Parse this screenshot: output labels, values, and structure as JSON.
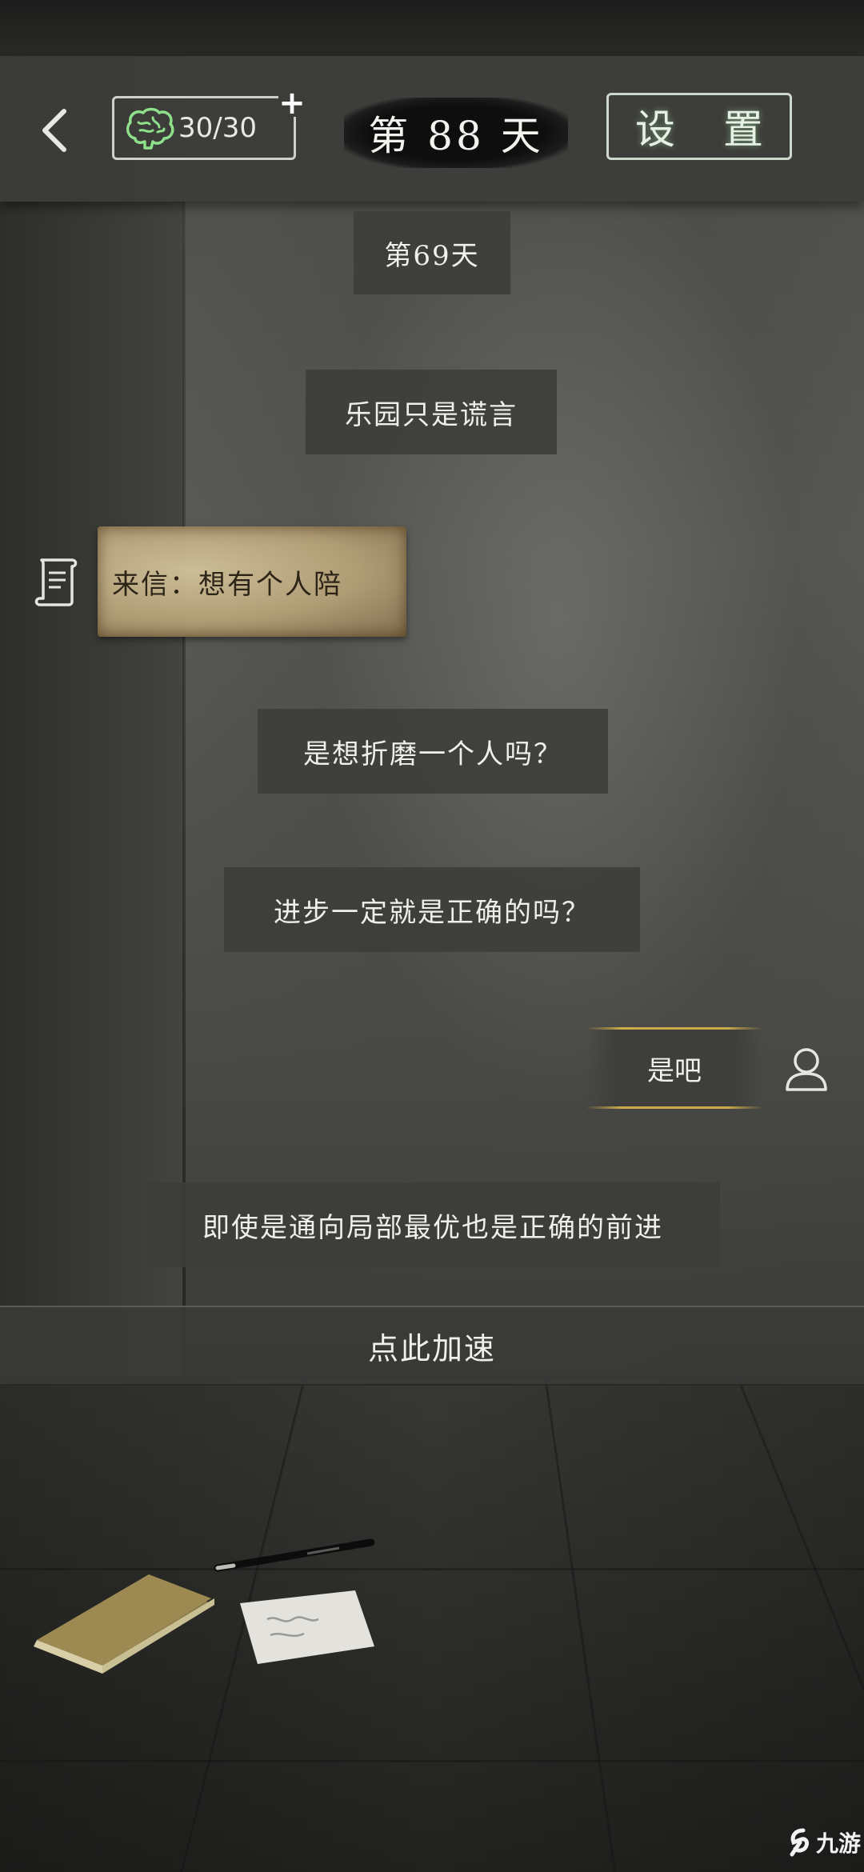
{
  "header": {
    "energy_value": "30/30",
    "energy_plus": "+",
    "day_title": "第 88 天",
    "settings_label": "设 置"
  },
  "story": {
    "day_label": "第69天",
    "messages": [
      "乐园只是谎言",
      "是想折磨一个人吗？",
      "进步一定就是正确的吗？",
      "即使是通向局部最优也是正确的前进"
    ],
    "letter_text": "来信：想有个人陪",
    "player_choice": "是吧"
  },
  "speedup_label": "点此加速",
  "watermark": {
    "text": "九游"
  },
  "icons": {
    "back": "chevron-left-icon",
    "energy": "brain-icon",
    "letter": "scroll-icon",
    "player": "user-icon",
    "watermark": "jiuyou-logo-icon"
  },
  "colors": {
    "settings_glow": "#a0e6a0",
    "choice_gold": "#c9a94a",
    "letter_paper": "#c8b488"
  }
}
